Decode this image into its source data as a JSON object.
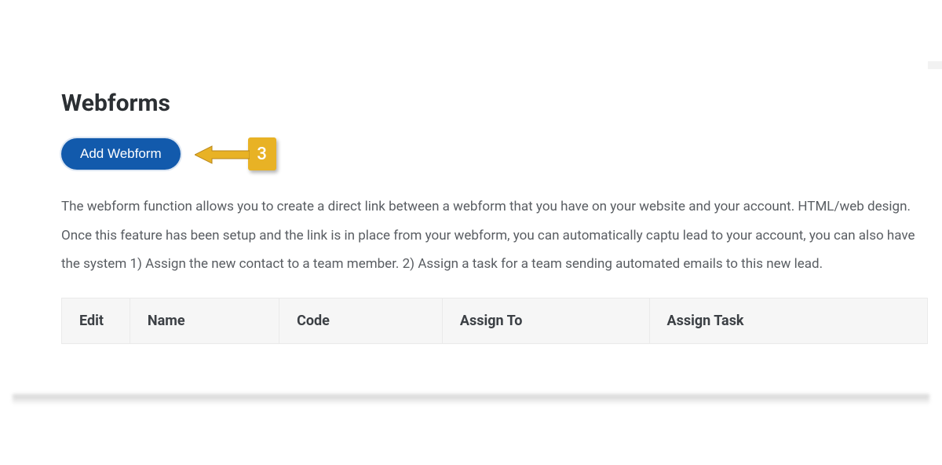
{
  "page": {
    "title": "Webforms"
  },
  "actions": {
    "add_label": "Add Webform"
  },
  "callout": {
    "step": "3"
  },
  "description": "The webform function allows you to create a direct link between a webform that you have on your website and your account. HTML/web design. Once this feature has been setup and the link is in place from your webform, you can automatically captu lead to your account, you can also have the system 1) Assign the new contact to a team member. 2) Assign a task for a team sending automated emails to this new lead.",
  "table": {
    "columns": {
      "edit": "Edit",
      "name": "Name",
      "code": "Code",
      "assign_to": "Assign To",
      "assign_task": "Assign Task"
    }
  },
  "colors": {
    "primary": "#125aac",
    "callout": "#e8b225"
  }
}
